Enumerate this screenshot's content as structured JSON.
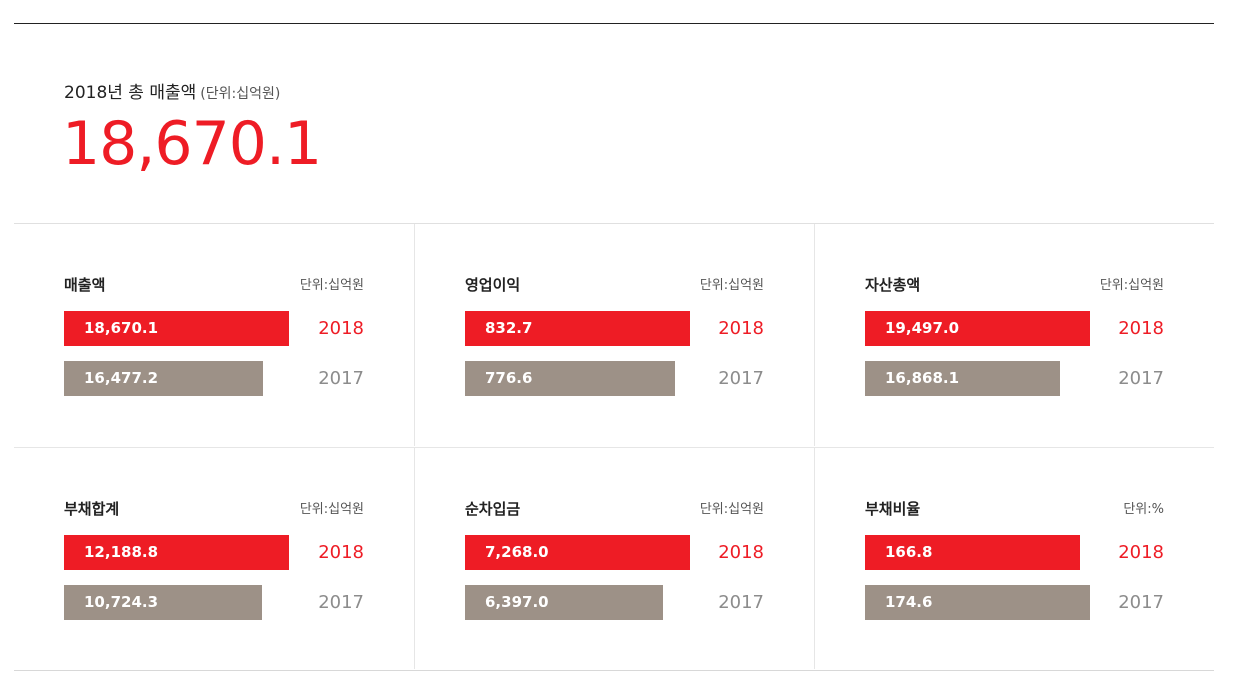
{
  "summary": {
    "label": "2018년 총 매출액",
    "unit": "(단위:십억원)",
    "value": "18,670.1"
  },
  "colors": {
    "accent": "#ee1c25",
    "previous": "#9d9187",
    "year_2017_text": "#8c8c8c"
  },
  "chart_data": [
    {
      "type": "bar",
      "title": "매출액",
      "unit": "단위:십억원",
      "categories": [
        "2018",
        "2017"
      ],
      "values": [
        18670.1,
        16477.2
      ],
      "value_labels": [
        "18,670.1",
        "16,477.2"
      ]
    },
    {
      "type": "bar",
      "title": "영업이익",
      "unit": "단위:십억원",
      "categories": [
        "2018",
        "2017"
      ],
      "values": [
        832.7,
        776.6
      ],
      "value_labels": [
        "832.7",
        "776.6"
      ]
    },
    {
      "type": "bar",
      "title": "자산총액",
      "unit": "단위:십억원",
      "categories": [
        "2018",
        "2017"
      ],
      "values": [
        19497.0,
        16868.1
      ],
      "value_labels": [
        "19,497.0",
        "16,868.1"
      ]
    },
    {
      "type": "bar",
      "title": "부채합계",
      "unit": "단위:십억원",
      "categories": [
        "2018",
        "2017"
      ],
      "values": [
        12188.8,
        10724.3
      ],
      "value_labels": [
        "12,188.8",
        "10,724.3"
      ]
    },
    {
      "type": "bar",
      "title": "순차입금",
      "unit": "단위:십억원",
      "categories": [
        "2018",
        "2017"
      ],
      "values": [
        7268.0,
        6397.0
      ],
      "value_labels": [
        "7,268.0",
        "6,397.0"
      ]
    },
    {
      "type": "bar",
      "title": "부채비율",
      "unit": "단위:%",
      "categories": [
        "2018",
        "2017"
      ],
      "values": [
        166.8,
        174.6
      ],
      "value_labels": [
        "166.8",
        "174.6"
      ]
    }
  ]
}
